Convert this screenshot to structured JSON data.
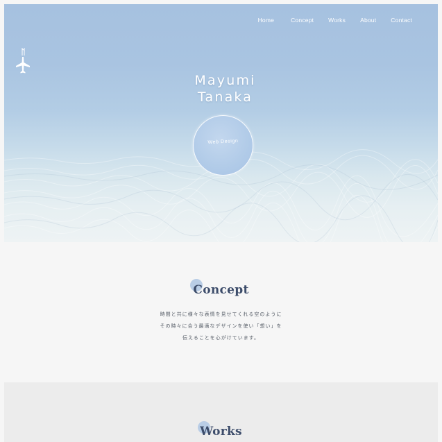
{
  "nav": {
    "items": [
      "Home",
      "Concept",
      "Works",
      "About",
      "Contact"
    ]
  },
  "hero": {
    "name_line1": "Mayumi",
    "name_line2": "Tanaka",
    "badge_text": "Web Design"
  },
  "concept": {
    "title": "Concept",
    "lines": [
      "時間と共に様々な表情を見せてくれる空のように",
      "その時々に合う最適なデザインを使い「想い」を",
      "伝えることを心がけています。"
    ]
  },
  "works": {
    "title": "Works"
  },
  "colors": {
    "sky_top": "#a6c1e0",
    "cloud": "#eef3f4",
    "title_navy": "#3d4d6b",
    "accent_dot": "#b9cde6",
    "works_bg": "#ececec"
  },
  "icons": {
    "logo": "airplane-logo-icon"
  }
}
